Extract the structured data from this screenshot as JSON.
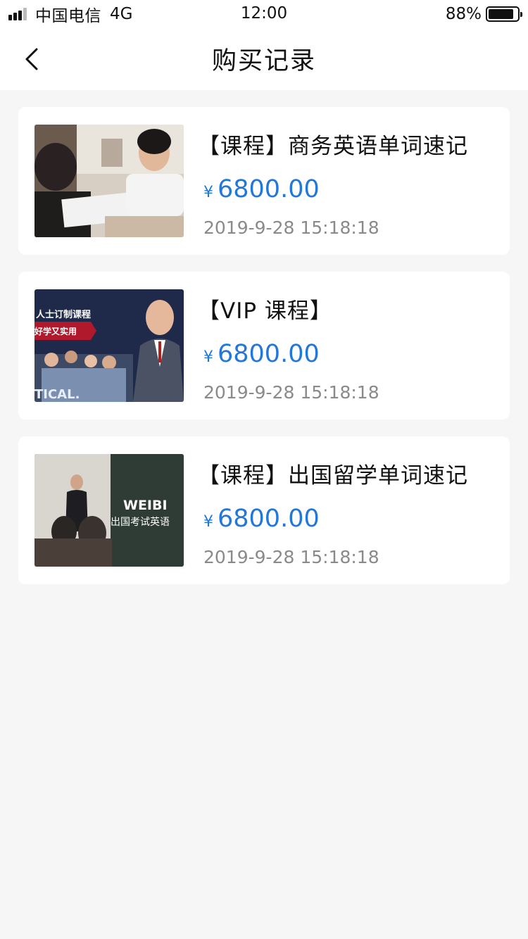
{
  "status_bar": {
    "carrier": "中国电信",
    "network": "4G",
    "time": "12:00",
    "battery": "88%",
    "battery_level": 0.88
  },
  "header": {
    "title": "购买记录",
    "back_icon": "chevron-left-icon"
  },
  "records": [
    {
      "title": "【课程】商务英语单词速记",
      "currency": "¥",
      "price": "6800.00",
      "date": "2019-9-28 15:18:18"
    },
    {
      "title": "【VIP 课程】",
      "currency": "¥",
      "price": "6800.00",
      "date": "2019-9-28 15:18:18",
      "thumb_text": [
        "人士订制课程",
        "好学又实用",
        "TICAL."
      ]
    },
    {
      "title": "【课程】出国留学单词速记",
      "currency": "¥",
      "price": "6800.00",
      "date": "2019-9-28 15:18:18",
      "thumb_text": [
        "WEIBI",
        "出国考试英语"
      ]
    }
  ],
  "colors": {
    "price": "#2377d6",
    "date": "#8a8a8a",
    "background": "#f6f6f6"
  }
}
